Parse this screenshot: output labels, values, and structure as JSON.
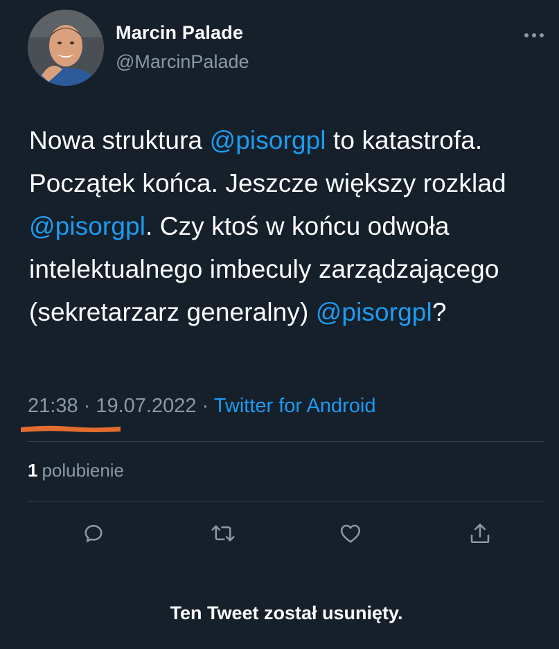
{
  "author": {
    "display_name": "Marcin Palade",
    "handle": "@MarcinPalade"
  },
  "tweet": {
    "segments": [
      {
        "text": "Nowa struktura ",
        "type": "text"
      },
      {
        "text": "@pisorgpl",
        "type": "mention"
      },
      {
        "text": " to katastrofa. Początek końca. Jeszcze większy rozklad ",
        "type": "text"
      },
      {
        "text": "@pisorgpl",
        "type": "mention"
      },
      {
        "text": ". Czy ktoś w końcu odwoła intelektualnego imbeculy zarządzającego (sekretarzarz generalny) ",
        "type": "text"
      },
      {
        "text": "@pisorgpl",
        "type": "mention"
      },
      {
        "text": "?",
        "type": "text"
      }
    ],
    "time": "21:38",
    "separator": " · ",
    "date": "19.07.2022",
    "source": "Twitter for Android"
  },
  "stats": {
    "likes_count": "1",
    "likes_label": "polubienie"
  },
  "actions": {
    "reply_icon": "reply-icon",
    "retweet_icon": "retweet-icon",
    "like_icon": "heart-icon",
    "share_icon": "share-icon"
  },
  "notice": "Ten Tweet został usunięty.",
  "colors": {
    "background": "#15202b",
    "text": "#ffffff",
    "secondary_text": "#8b98a5",
    "link": "#1d9bf0",
    "divider": "#38444d",
    "highlight_underline": "#e36d2f"
  }
}
